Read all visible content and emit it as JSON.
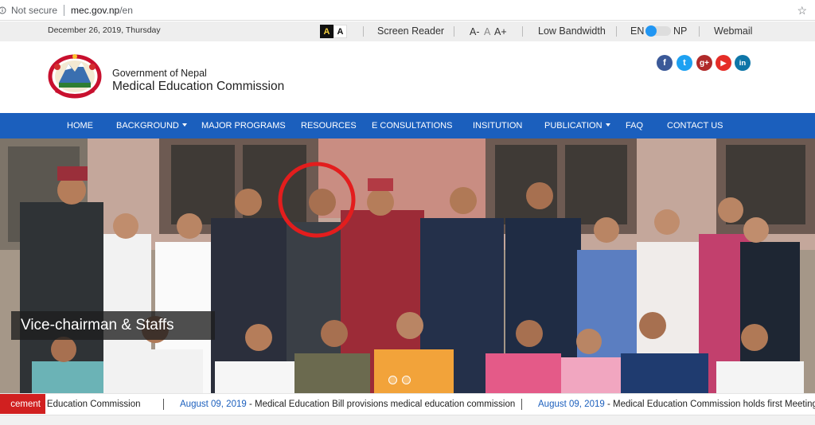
{
  "browser": {
    "security_label": "Not secure",
    "url_host": "mec.gov.np",
    "url_path": "/en",
    "icons": [
      "info-icon",
      "bookmark-star-icon"
    ]
  },
  "utility": {
    "date": "December 26, 2019, Thursday",
    "contrast_dark": "A",
    "contrast_light": "A",
    "screen_reader": "Screen Reader",
    "font_decrease": "A-",
    "font_normal": "A",
    "font_increase": "A+",
    "low_bandwidth": "Low Bandwidth",
    "lang_en": "EN",
    "lang_np": "NP",
    "webmail": "Webmail"
  },
  "header": {
    "gov_name": "Government of Nepal",
    "commission_name": "Medical Education Commission",
    "social": [
      {
        "name": "facebook-icon",
        "glyph": "f",
        "color": "#3b5998"
      },
      {
        "name": "twitter-icon",
        "glyph": "t",
        "color": "#1da1f2"
      },
      {
        "name": "google-plus-icon",
        "glyph": "g+",
        "color": "#b02a2a"
      },
      {
        "name": "youtube-icon",
        "glyph": "▶",
        "color": "#e52d27"
      },
      {
        "name": "linkedin-icon",
        "glyph": "in",
        "color": "#0e76a8"
      }
    ]
  },
  "nav": {
    "items": [
      {
        "label": "HOME",
        "dropdown": false
      },
      {
        "label": "BACKGROUND",
        "dropdown": true
      },
      {
        "label": "MAJOR PROGRAMS",
        "dropdown": false
      },
      {
        "label": "RESOURCES",
        "dropdown": false
      },
      {
        "label": "E CONSULTATIONS",
        "dropdown": false
      },
      {
        "label": "INSITUTION",
        "dropdown": false
      },
      {
        "label": "PUBLICATION",
        "dropdown": true
      },
      {
        "label": "FAQ",
        "dropdown": false
      },
      {
        "label": "CONTACT US",
        "dropdown": false
      }
    ]
  },
  "slider": {
    "caption": "Vice-chairman & Staffs",
    "slide_count": 2,
    "active_slide": 1
  },
  "ticker": {
    "label": "cement",
    "items": [
      {
        "date": "",
        "text": "cal Education Commission"
      },
      {
        "date": "August 09, 2019",
        "text": " - Medical Education Bill provisions medical education commission"
      },
      {
        "date": "August 09, 2019",
        "text": " - Medical Education Commission holds first Meeting,"
      }
    ]
  }
}
